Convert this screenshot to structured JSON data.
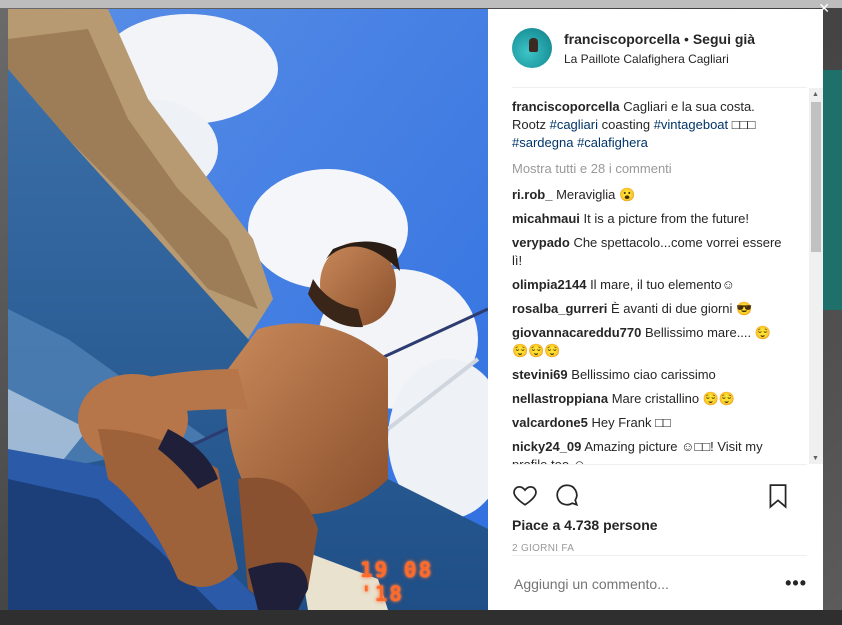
{
  "post": {
    "username": "franciscoporcella",
    "separator": "•",
    "follow_label": "Segui già",
    "location": "La Paillote Calafighera Cagliari",
    "date_stamp": "19 08 '18"
  },
  "caption": {
    "username": "franciscoporcella",
    "text1": "Cagliari e la sua costa. Rootz",
    "tag1": "#cagliari",
    "text2": "coasting",
    "tag2": "#vintageboat",
    "emoji": "□□□",
    "tag3": "#sardegna",
    "tag4": "#calafighera"
  },
  "more_comments": "Mostra tutti e 28 i commenti",
  "comments": [
    {
      "user": "ri.rob_",
      "text": "Meraviglia 😮"
    },
    {
      "user": "micahmaui",
      "text": "It is a picture from the future!"
    },
    {
      "user": "verypado",
      "text": "Che spettacolo...come vorrei essere lì!"
    },
    {
      "user": "olimpia2144",
      "text": "Il mare, il tuo elemento☺"
    },
    {
      "user": "rosalba_gurreri",
      "text": "È avanti di due giorni 😎"
    },
    {
      "user": "giovannacareddu770",
      "text": "Bellissimo mare.... 😌 😌😌😌"
    },
    {
      "user": "stevini69",
      "text": "Bellissimo ciao carissimo"
    },
    {
      "user": "nellastroppiana",
      "text": "Mare cristallino 😌😌"
    },
    {
      "user": "valcardone5",
      "text": "Hey Frank □□"
    },
    {
      "user": "nicky24_09",
      "text": "Amazing picture ☺□□! Visit my profile too ☺"
    }
  ],
  "actions": {
    "likes_prefix": "Piace a",
    "likes_count": "4.738",
    "likes_suffix": "persone",
    "timestamp": "2 GIORNI FA"
  },
  "add_comment_placeholder": "Aggiungi un commento...",
  "options_label": "•••",
  "icons": {
    "like": "heart-icon",
    "comment": "comment-icon",
    "save": "bookmark-icon",
    "options": "more-options-icon"
  },
  "colors": {
    "hashtag": "#003569",
    "muted": "#999999",
    "text": "#262626",
    "date_stamp": "#ff6a2a"
  }
}
